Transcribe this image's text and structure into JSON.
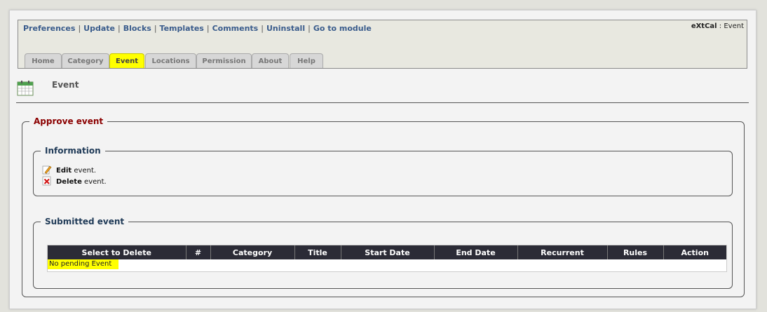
{
  "admin": {
    "links": [
      "Preferences",
      "Update",
      "Blocks",
      "Templates",
      "Comments",
      "Uninstall",
      "Go to module"
    ],
    "module_name": "eXtCal",
    "module_sep": " : ",
    "module_page": "Event",
    "tabs": [
      "Home",
      "Category",
      "Event",
      "Locations",
      "Permission",
      "About",
      "Help"
    ],
    "active_tab": "Event"
  },
  "page": {
    "title": "Event",
    "icon": "calendar-icon"
  },
  "approve": {
    "legend": "Approve event",
    "info": {
      "legend": "Information",
      "edit_bold": "Edit",
      "edit_rest": " event.",
      "delete_bold": "Delete",
      "delete_rest": " event."
    },
    "submitted": {
      "legend": "Submitted event",
      "columns": [
        "Select to Delete",
        "#",
        "Category",
        "Title",
        "Start Date",
        "End Date",
        "Recurrent",
        "Rules",
        "Action"
      ],
      "empty_message": "No pending Event"
    }
  },
  "colors": {
    "accent": "#ffff00",
    "legend_red": "#8b0000",
    "legend_blue": "#1f3a57",
    "link": "#3a5c8c"
  }
}
